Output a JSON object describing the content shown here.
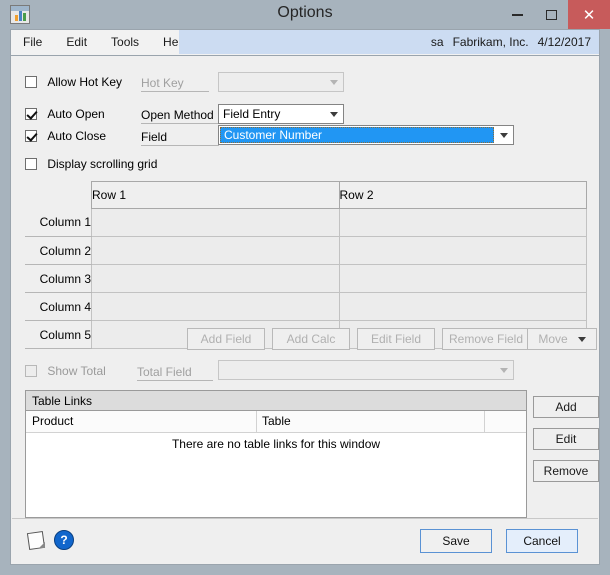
{
  "window": {
    "title": "Options",
    "icon": "window-chart-icon",
    "controls": {
      "minimize": "–",
      "maximize": "□",
      "close": "✕"
    }
  },
  "menubar": {
    "items": [
      "File",
      "Edit",
      "Tools",
      "Help"
    ],
    "user": "sa",
    "company": "Fabrikam, Inc.",
    "date": "4/12/2017"
  },
  "options": {
    "allow_hot_key": {
      "label": "Allow Hot Key",
      "checked": false
    },
    "hot_key": {
      "label": "Hot Key",
      "value": "",
      "disabled": true
    },
    "auto_open": {
      "label": "Auto Open",
      "checked": true
    },
    "auto_close": {
      "label": "Auto Close",
      "checked": true
    },
    "open_method": {
      "label": "Open Method",
      "value": "Field Entry"
    },
    "field": {
      "label": "Field",
      "value": "Customer Number",
      "focused": true
    },
    "display_scrolling_grid": {
      "label": "Display scrolling grid",
      "checked": false
    }
  },
  "grid": {
    "column_headers": [
      "Row 1",
      "Row 2"
    ],
    "row_labels": [
      "Column 1",
      "Column 2",
      "Column 3",
      "Column 4",
      "Column 5"
    ],
    "cells": [
      [
        "",
        ""
      ],
      [
        "",
        ""
      ],
      [
        "",
        ""
      ],
      [
        "",
        ""
      ],
      [
        "",
        ""
      ]
    ]
  },
  "field_buttons": [
    {
      "label": "Add Field",
      "enabled": false
    },
    {
      "label": "Add Calc",
      "enabled": false
    },
    {
      "label": "Edit Field",
      "enabled": false
    },
    {
      "label": "Remove Field",
      "enabled": false
    },
    {
      "label": "Move",
      "enabled": false,
      "has_arrow": true
    }
  ],
  "total": {
    "show_total": {
      "label": "Show Total",
      "checked": false,
      "disabled": true
    },
    "total_field": {
      "label": "Total Field",
      "value": "",
      "disabled": true
    }
  },
  "table_links": {
    "title": "Table Links",
    "columns": [
      "Product",
      "Table"
    ],
    "empty_message": "There are no table links for this window",
    "buttons": [
      "Add",
      "Edit",
      "Remove"
    ]
  },
  "bottom": {
    "note_icon": "note-icon",
    "help_icon": "?",
    "save": "Save",
    "cancel": "Cancel"
  }
}
